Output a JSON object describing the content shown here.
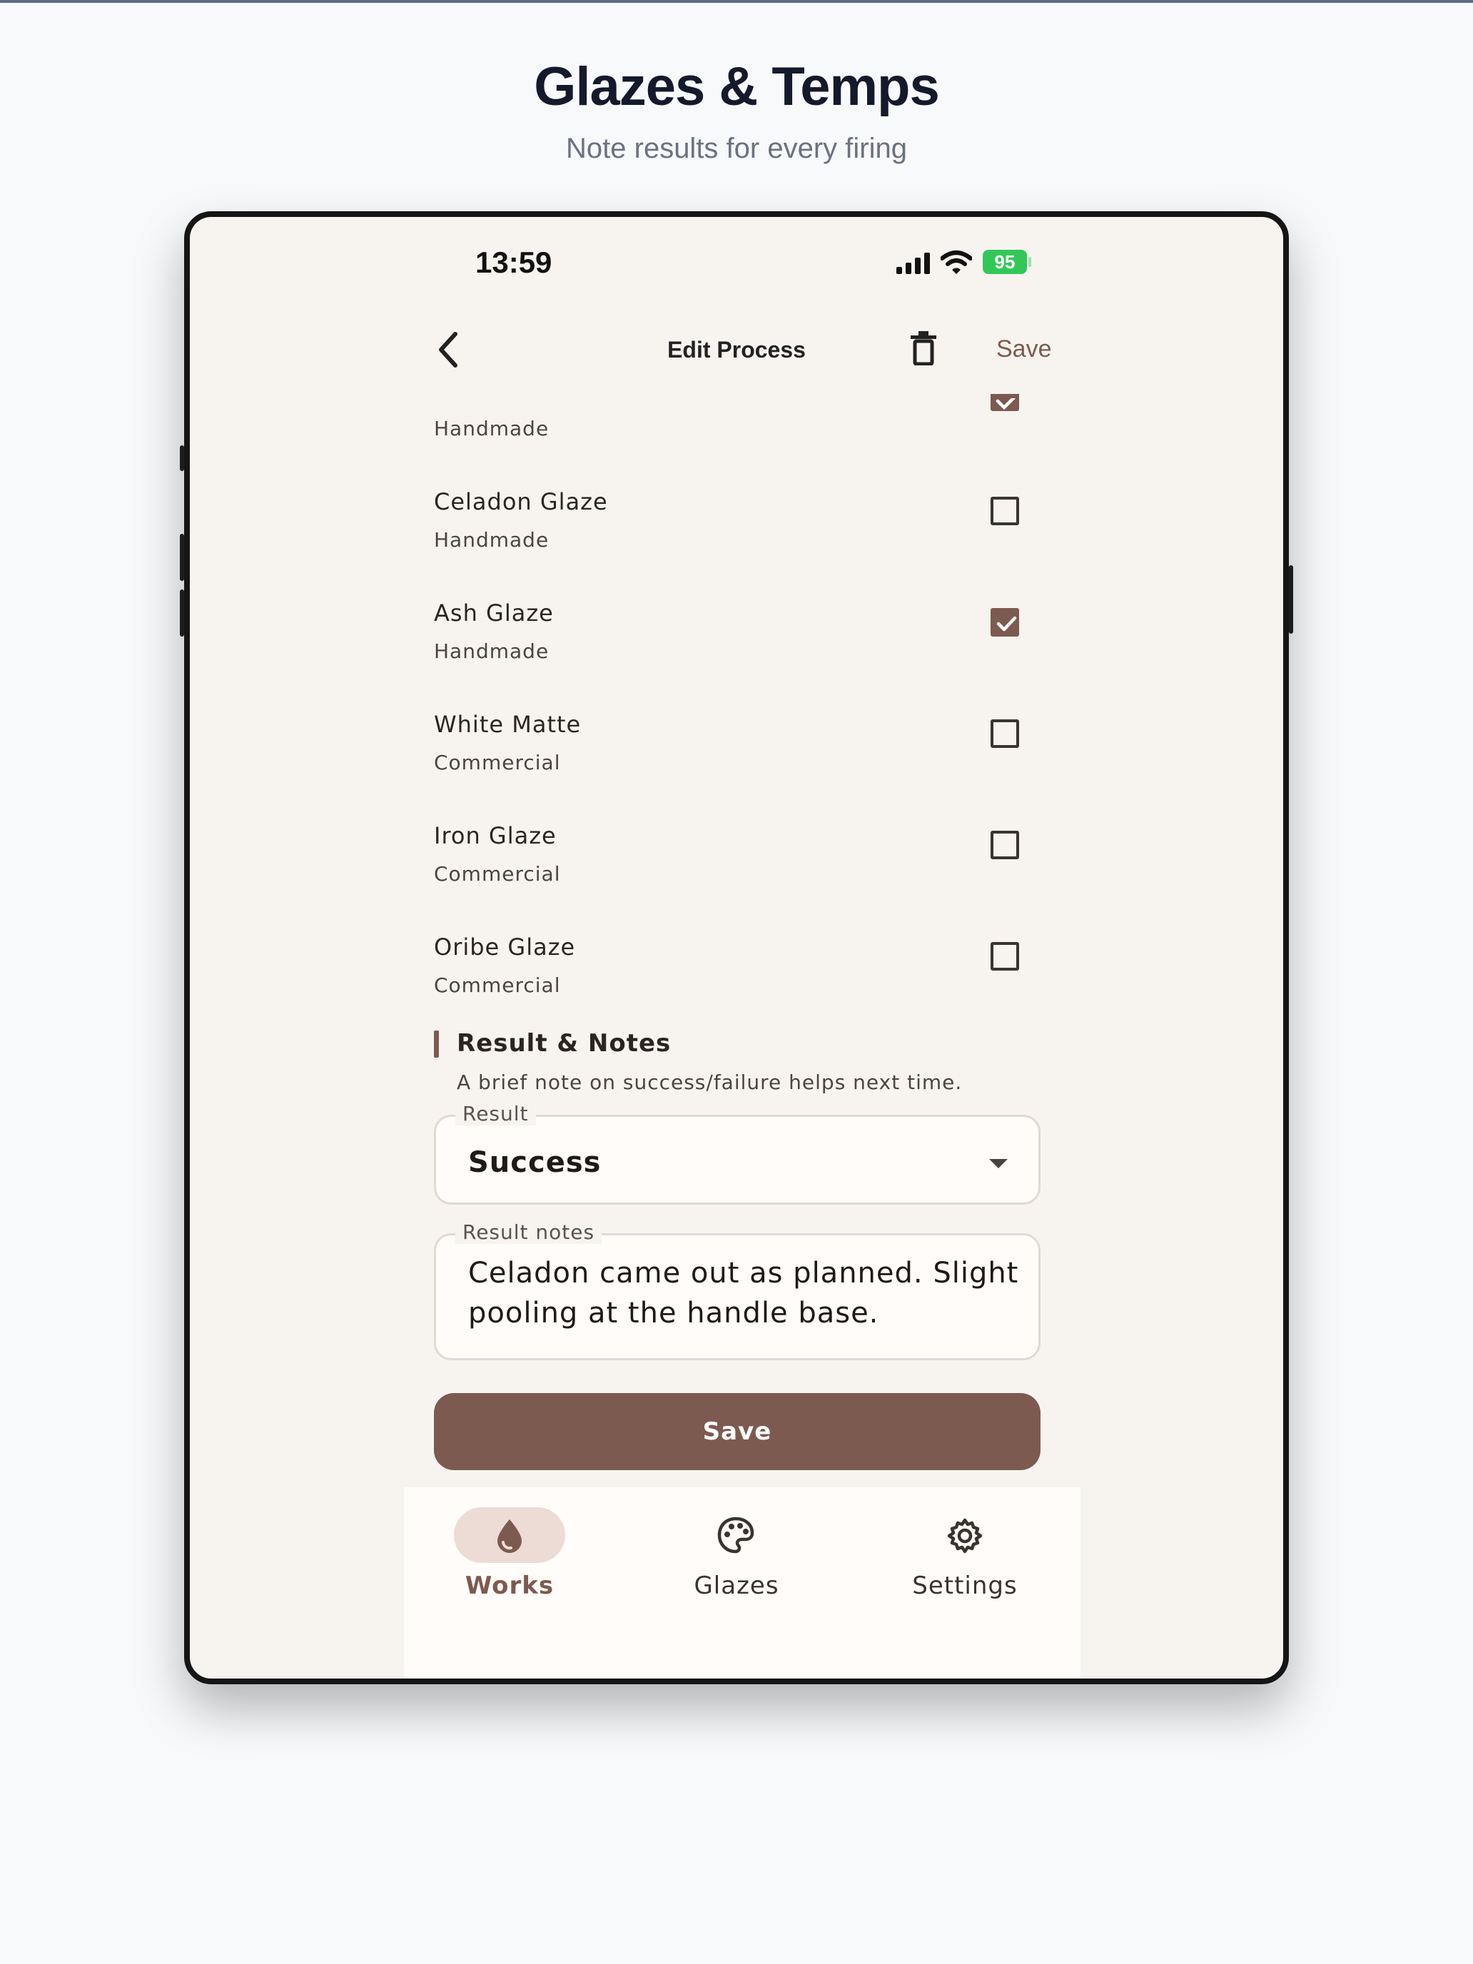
{
  "hero": {
    "title": "Glazes & Temps",
    "subtitle": "Note results for every firing"
  },
  "status_bar": {
    "time": "13:59",
    "battery": "95"
  },
  "nav": {
    "back_icon": "chevron-left-icon",
    "title": "Edit Process",
    "delete_icon": "trash-icon",
    "save_label": "Save"
  },
  "glaze_list": {
    "partial_item": {
      "sub": "Handmade",
      "checked": true
    },
    "items": [
      {
        "name": "Celadon Glaze",
        "sub": "Handmade",
        "checked": false
      },
      {
        "name": "Ash Glaze",
        "sub": "Handmade",
        "checked": true
      },
      {
        "name": "White Matte",
        "sub": "Commercial",
        "checked": false
      },
      {
        "name": "Iron Glaze",
        "sub": "Commercial",
        "checked": false
      },
      {
        "name": "Oribe Glaze",
        "sub": "Commercial",
        "checked": false
      }
    ]
  },
  "result_section": {
    "title": "Result & Notes",
    "subtitle": "A brief note on success/failure helps next time.",
    "result_label": "Result",
    "result_value": "Success",
    "notes_label": "Result notes",
    "notes_value": "Celadon came out as planned. Slight pooling at the handle base.",
    "save_label": "Save"
  },
  "bottom_nav": {
    "tabs": [
      {
        "label": "Works",
        "icon": "water-drop-icon",
        "active": true
      },
      {
        "label": "Glazes",
        "icon": "palette-icon",
        "active": false
      },
      {
        "label": "Settings",
        "icon": "gear-icon",
        "active": false
      }
    ]
  },
  "colors": {
    "accent": "#7d5a50",
    "background": "#f7f4f0",
    "active_pill": "#ecdcd5",
    "battery": "#33c759"
  }
}
